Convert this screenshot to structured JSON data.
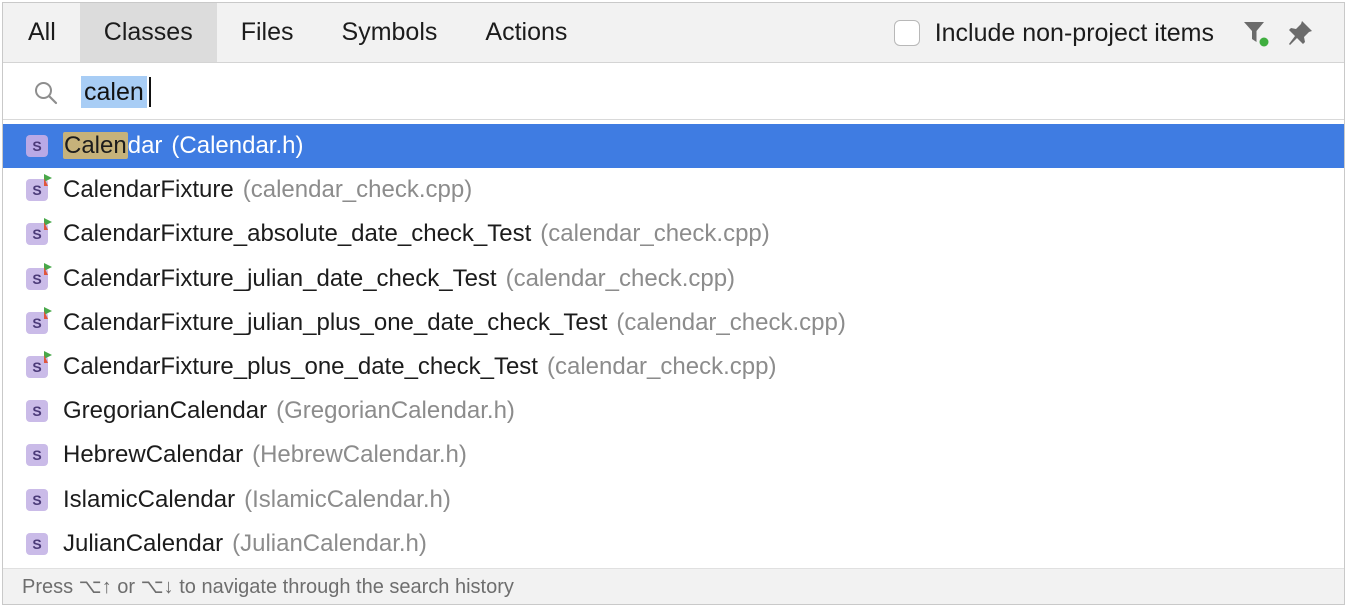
{
  "tabs": [
    {
      "label": "All",
      "active": false
    },
    {
      "label": "Classes",
      "active": true
    },
    {
      "label": "Files",
      "active": false
    },
    {
      "label": "Symbols",
      "active": false
    },
    {
      "label": "Actions",
      "active": false
    }
  ],
  "header": {
    "checkbox_label": "Include non-project items",
    "checkbox_checked": false,
    "filter_icon": "filter-icon",
    "pin_icon": "pin-icon"
  },
  "search": {
    "value": "calen",
    "icon": "search-icon"
  },
  "results": [
    {
      "highlight": "Calen",
      "rest": "dar",
      "file": "(Calendar.h)",
      "icon": "struct-icon",
      "selected": true
    },
    {
      "highlight": "",
      "rest": "CalendarFixture",
      "file": "(calendar_check.cpp)",
      "icon": "struct-test-icon",
      "selected": false
    },
    {
      "highlight": "",
      "rest": "CalendarFixture_absolute_date_check_Test",
      "file": "(calendar_check.cpp)",
      "icon": "struct-test-icon",
      "selected": false
    },
    {
      "highlight": "",
      "rest": "CalendarFixture_julian_date_check_Test",
      "file": "(calendar_check.cpp)",
      "icon": "struct-test-icon",
      "selected": false
    },
    {
      "highlight": "",
      "rest": "CalendarFixture_julian_plus_one_date_check_Test",
      "file": "(calendar_check.cpp)",
      "icon": "struct-test-icon",
      "selected": false
    },
    {
      "highlight": "",
      "rest": "CalendarFixture_plus_one_date_check_Test",
      "file": "(calendar_check.cpp)",
      "icon": "struct-test-icon",
      "selected": false
    },
    {
      "highlight": "",
      "rest": "GregorianCalendar",
      "file": "(GregorianCalendar.h)",
      "icon": "struct-icon",
      "selected": false
    },
    {
      "highlight": "",
      "rest": "HebrewCalendar",
      "file": "(HebrewCalendar.h)",
      "icon": "struct-icon",
      "selected": false
    },
    {
      "highlight": "",
      "rest": "IslamicCalendar",
      "file": "(IslamicCalendar.h)",
      "icon": "struct-icon",
      "selected": false
    },
    {
      "highlight": "",
      "rest": "JulianCalendar",
      "file": "(JulianCalendar.h)",
      "icon": "struct-icon",
      "selected": false
    }
  ],
  "struct_letter": "S",
  "footer": {
    "hint": "Press ⌥↑ or ⌥↓ to navigate through the search history"
  },
  "colors": {
    "selection": "#3f7ce2",
    "match_highlight": "#c6b27a",
    "struct_badge": "#cabbe8"
  }
}
